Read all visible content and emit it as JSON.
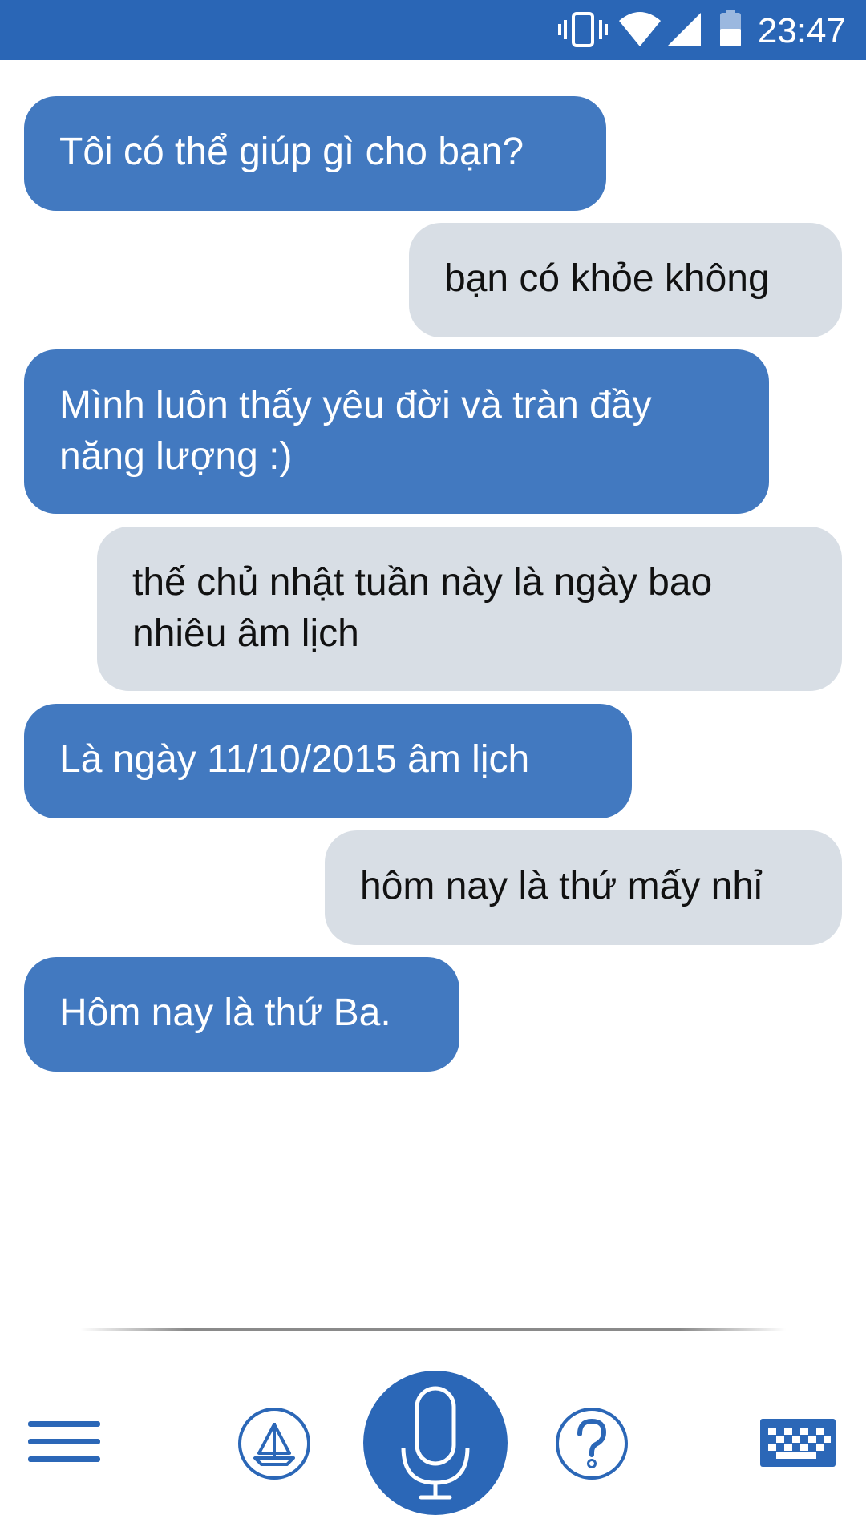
{
  "status_bar": {
    "time": "23:47",
    "icons": [
      "vibrate-icon",
      "wifi-icon",
      "cell-signal-icon",
      "battery-icon"
    ],
    "background": "#2a66b6"
  },
  "conversation": {
    "messages": [
      {
        "sender": "assistant",
        "text": "Tôi có thể giúp gì cho bạn?"
      },
      {
        "sender": "user",
        "text": "bạn có khỏe không"
      },
      {
        "sender": "assistant",
        "text": "Mình luôn thấy yêu đời và tràn đầy năng lượng :)"
      },
      {
        "sender": "user",
        "text": "thế chủ nhật tuần này là ngày bao nhiêu âm lịch"
      },
      {
        "sender": "assistant",
        "text": "Là ngày 11/10/2015 âm lịch"
      },
      {
        "sender": "user",
        "text": "hôm nay là thứ mấy nhỉ"
      },
      {
        "sender": "assistant",
        "text": "Hôm nay là thứ Ba."
      }
    ]
  },
  "toolbar": {
    "items": [
      "menu-icon",
      "boat-icon",
      "microphone-icon",
      "help-icon",
      "keyboard-icon"
    ]
  },
  "colors": {
    "assistant_bubble": "#4279c0",
    "user_bubble": "#d8dee5",
    "accent": "#2b67b7"
  }
}
